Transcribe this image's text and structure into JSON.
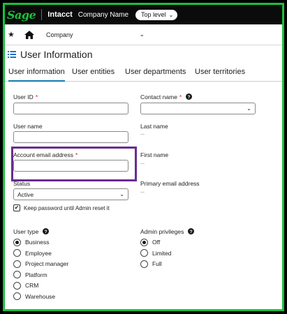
{
  "topbar": {
    "logo": "Sage",
    "product": "Intacct",
    "company_name": "Company Name",
    "level": "Top level"
  },
  "navbar": {
    "company": "Company"
  },
  "page": {
    "title": "User Information"
  },
  "tabs": [
    {
      "label": "User information",
      "active": true
    },
    {
      "label": "User entities"
    },
    {
      "label": "User departments"
    },
    {
      "label": "User territories"
    }
  ],
  "form": {
    "user_id_label": "User ID",
    "user_id_value": "",
    "contact_name_label": "Contact name",
    "contact_name_value": "",
    "user_name_label": "User name",
    "user_name_value": "",
    "last_name_label": "Last name",
    "last_name_value": "--",
    "account_email_label": "Account email address",
    "account_email_value": "",
    "first_name_label": "First name",
    "first_name_value": "--",
    "status_label": "Status",
    "status_value": "Active",
    "primary_email_label": "Primary email address",
    "primary_email_value": "--",
    "keep_password_label": "Keep password until Admin reset it",
    "required_mark": "*"
  },
  "user_type": {
    "label": "User type",
    "options": [
      "Business",
      "Employee",
      "Project manager",
      "Platform",
      "CRM",
      "Warehouse"
    ],
    "selected": "Business"
  },
  "admin_privileges": {
    "label": "Admin privileges",
    "options": [
      "Off",
      "Limited",
      "Full"
    ],
    "selected": "Off"
  },
  "colors": {
    "brand_green": "#18c23b",
    "frame_green": "#19c23c",
    "highlight_purple": "#6a2c91",
    "tab_active": "#0f7bb0",
    "required_red": "#d61c1c"
  }
}
